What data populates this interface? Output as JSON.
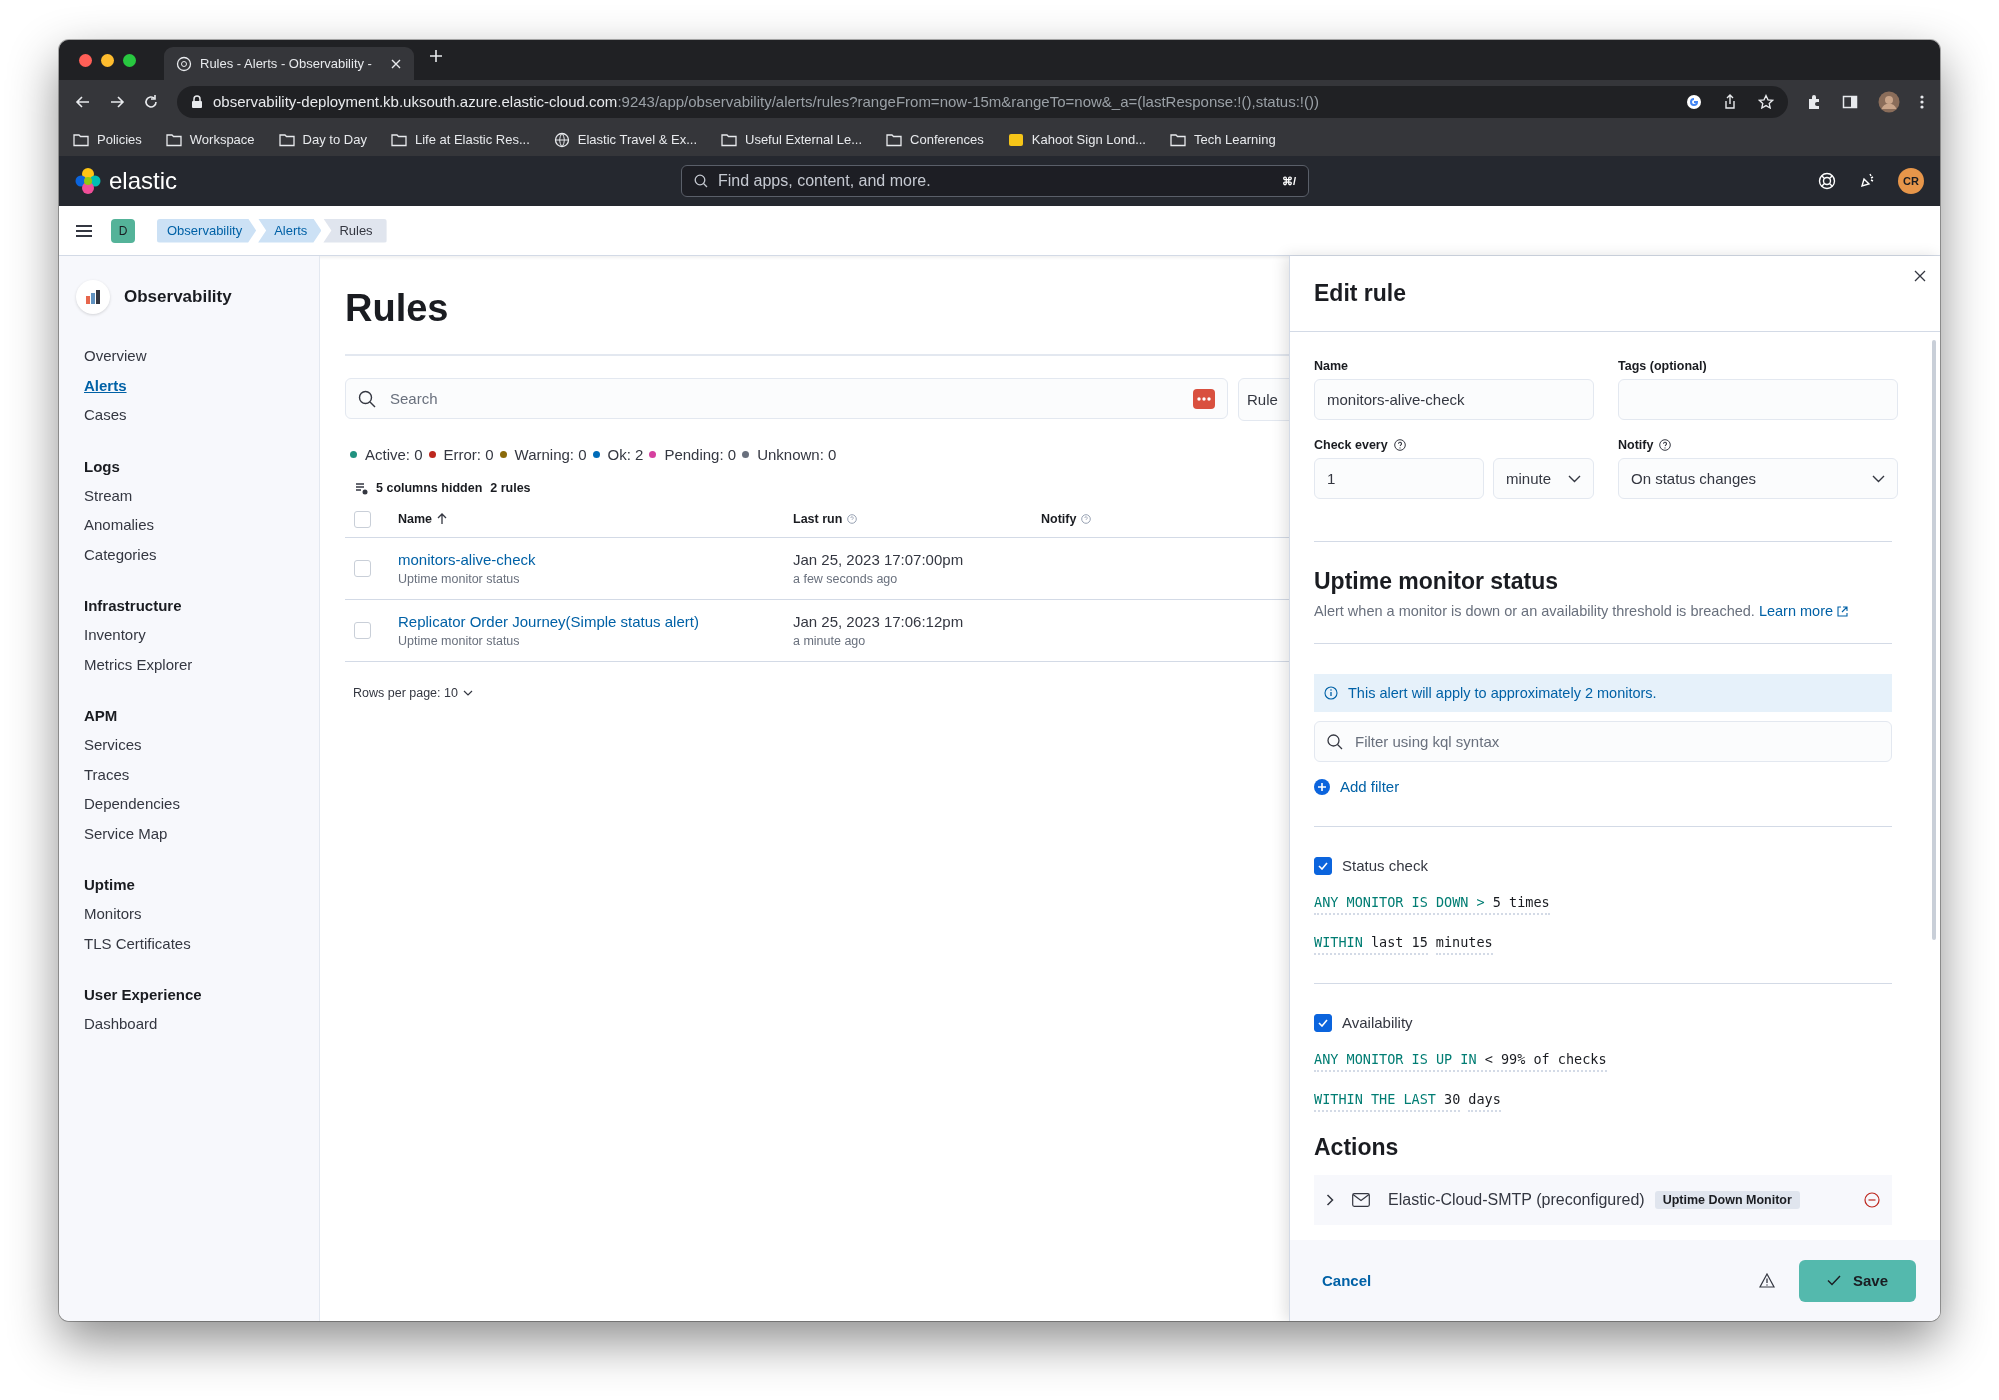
{
  "browser": {
    "tab_title": "Rules - Alerts - Observability -",
    "url_host": "observability-deployment.kb.uksouth.azure.elastic-cloud.com",
    "url_path": ":9243/app/observability/alerts/rules?rangeFrom=now-15m&rangeTo=now&_a=(lastResponse:!(),status:!())",
    "bookmarks": [
      {
        "label": "Policies",
        "kind": "folder"
      },
      {
        "label": "Workspace",
        "kind": "folder"
      },
      {
        "label": "Day to Day",
        "kind": "folder"
      },
      {
        "label": "Life at Elastic Res...",
        "kind": "folder"
      },
      {
        "label": "Elastic Travel & Ex...",
        "kind": "site"
      },
      {
        "label": "Useful External Le...",
        "kind": "folder"
      },
      {
        "label": "Conferences",
        "kind": "folder"
      },
      {
        "label": "Kahoot Sign Lond...",
        "kind": "app"
      },
      {
        "label": "Tech Learning",
        "kind": "folder"
      }
    ]
  },
  "header": {
    "brand": "elastic",
    "search_placeholder": "Find apps, content, and more.",
    "shortcut": "⌘/",
    "avatar": "CR"
  },
  "breadcrumbs": {
    "space": "D",
    "items": [
      {
        "label": "Observability",
        "selected": false
      },
      {
        "label": "Alerts",
        "selected": false
      },
      {
        "label": "Rules",
        "selected": true
      }
    ]
  },
  "sidebar": {
    "title": "Observability",
    "sections": [
      {
        "items": [
          {
            "label": "Overview",
            "selected": false
          },
          {
            "label": "Alerts",
            "selected": true
          },
          {
            "label": "Cases",
            "selected": false
          }
        ]
      },
      {
        "heading": "Logs",
        "items": [
          {
            "label": "Stream",
            "selected": false
          },
          {
            "label": "Anomalies",
            "selected": false
          },
          {
            "label": "Categories",
            "selected": false
          }
        ]
      },
      {
        "heading": "Infrastructure",
        "items": [
          {
            "label": "Inventory",
            "selected": false
          },
          {
            "label": "Metrics Explorer",
            "selected": false
          }
        ]
      },
      {
        "heading": "APM",
        "items": [
          {
            "label": "Services",
            "selected": false
          },
          {
            "label": "Traces",
            "selected": false
          },
          {
            "label": "Dependencies",
            "selected": false
          },
          {
            "label": "Service Map",
            "selected": false
          }
        ]
      },
      {
        "heading": "Uptime",
        "items": [
          {
            "label": "Monitors",
            "selected": false
          },
          {
            "label": "TLS Certificates",
            "selected": false
          }
        ]
      },
      {
        "heading": "User Experience",
        "items": [
          {
            "label": "Dashboard",
            "selected": false
          }
        ]
      }
    ]
  },
  "rules": {
    "title": "Rules",
    "search_placeholder": "Search",
    "rule_status_button": "Rule",
    "select_all": false,
    "status_counts": [
      {
        "label": "Active: 0",
        "color": "#209280"
      },
      {
        "label": "Error: 0",
        "color": "#bd271e"
      },
      {
        "label": "Warning: 0",
        "color": "#8a6a0a"
      },
      {
        "label": "Ok: 2",
        "color": "#006bb8"
      },
      {
        "label": "Pending: 0",
        "color": "#d6409f"
      },
      {
        "label": "Unknown: 0",
        "color": "#69707d"
      }
    ],
    "hidden_columns": "5 columns hidden",
    "rule_count": "2 rules",
    "columns": [
      "Name",
      "Last run",
      "Notify"
    ],
    "rows": [
      {
        "name": "monitors-alive-check",
        "type": "Uptime monitor status",
        "last_run": "Jan 25, 2023 17:07:00pm",
        "last_run_relative": "a few seconds ago",
        "selected": false
      },
      {
        "name": "Replicator Order Journey(Simple status alert)",
        "type": "Uptime monitor status",
        "last_run": "Jan 25, 2023 17:06:12pm",
        "last_run_relative": "a minute ago",
        "selected": false
      }
    ],
    "pagination": "Rows per page: 10"
  },
  "flyout": {
    "title": "Edit rule",
    "name_label": "Name",
    "name_value": "monitors-alive-check",
    "tags_label": "Tags (optional)",
    "check_every_label": "Check every",
    "interval_value": "1",
    "interval_unit": "minute",
    "notify_label": "Notify",
    "notify_value": "On status changes",
    "rule_type_title": "Uptime monitor status",
    "rule_type_description": "Alert when a monitor is down or an availability threshold is breached.",
    "learn_more": "Learn more",
    "callout": "This alert will apply to approximately 2 monitors.",
    "filter_placeholder": "Filter using kql syntax",
    "add_filter": "Add filter",
    "conditions": [
      {
        "label": "Status check",
        "checked": true,
        "expressions": [
          [
            {
              "keyword": "ANY MONITOR IS DOWN >",
              "value": "5 times"
            }
          ],
          [
            {
              "keyword": "WITHIN",
              "value": "last 15"
            },
            {
              "value": "minutes"
            }
          ]
        ]
      },
      {
        "label": "Availability",
        "checked": true,
        "expressions": [
          [
            {
              "keyword": "ANY MONITOR IS UP IN",
              "value": "< 99% of checks"
            }
          ],
          [
            {
              "keyword": "WITHIN THE LAST",
              "value": "30"
            },
            {
              "value": "days"
            }
          ]
        ]
      }
    ],
    "actions_title": "Actions",
    "actions": [
      {
        "connector": "Elastic-Cloud-SMTP (preconfigured)",
        "badge": "Uptime Down Monitor",
        "expanded": false
      }
    ],
    "cancel": "Cancel",
    "save": "Save"
  }
}
